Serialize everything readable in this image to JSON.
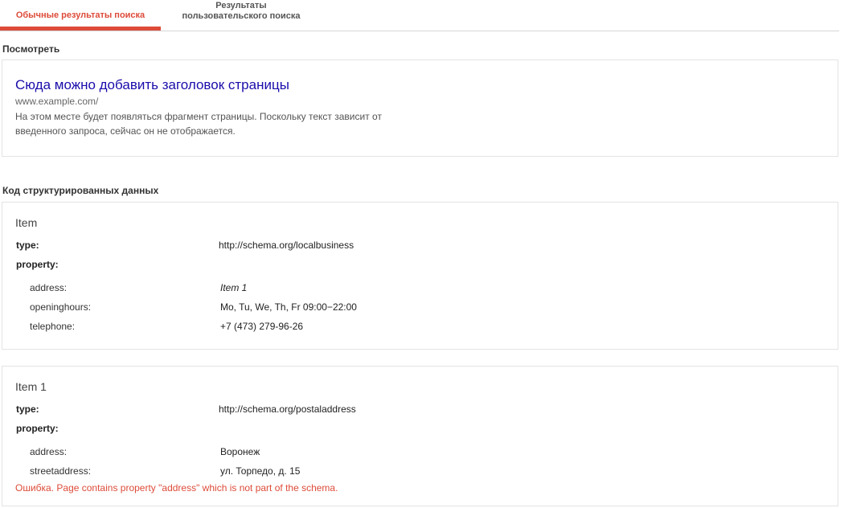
{
  "tabs": [
    {
      "label": "Обычные результаты поиска"
    },
    {
      "label_line1": "Результаты",
      "label_line2": "пользовательского поиска"
    }
  ],
  "preview": {
    "heading": "Посмотреть",
    "title": "Сюда можно добавить заголовок страницы",
    "url": "www.example.com/",
    "description_line1": "На этом месте будет появляться фрагмент страницы. Поскольку текст зависит от",
    "description_line2": "введенного запроса, сейчас он не отображается."
  },
  "structured": {
    "heading": "Код структурированных данных",
    "items": [
      {
        "name": "Item",
        "type_label": "type:",
        "type_value": "http://schema.org/localbusiness",
        "property_label": "property:",
        "properties": [
          {
            "key": "address:",
            "value": "Item 1"
          },
          {
            "key": "openinghours:",
            "value": "Mo, Tu, We, Th, Fr 09:00−22:00"
          },
          {
            "key": "telephone:",
            "value": "+7 (473) 279-96-26"
          }
        ]
      },
      {
        "name": "Item 1",
        "type_label": "type:",
        "type_value": "http://schema.org/postaladdress",
        "property_label": "property:",
        "properties": [
          {
            "key": "address:",
            "value": "Воронеж"
          },
          {
            "key": "streetaddress:",
            "value": "ул. Торпедо, д. 15"
          }
        ],
        "error": "Ошибка. Page contains property \"address\" which is not part of the schema."
      }
    ]
  },
  "colors": {
    "accent": "#dd4b39",
    "link": "#1a0dab",
    "error": "#dd4b39"
  }
}
